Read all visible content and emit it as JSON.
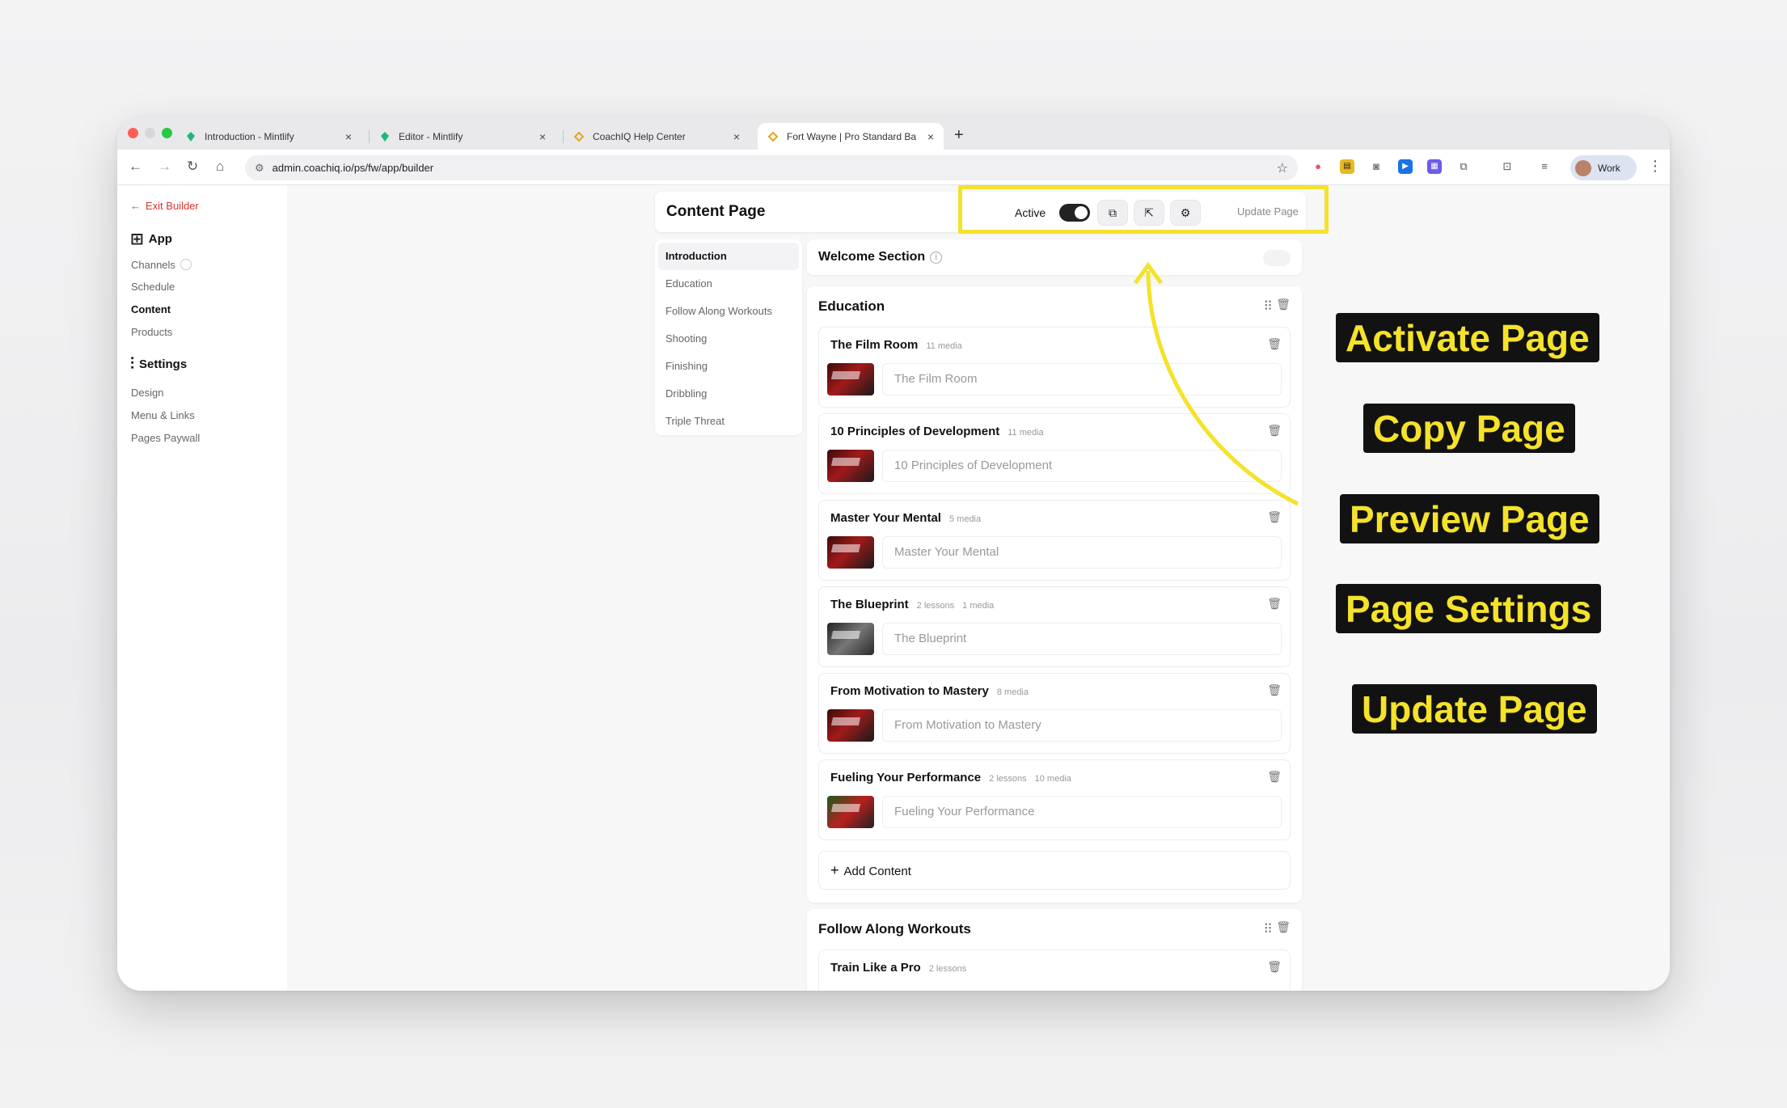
{
  "browser": {
    "tabs": [
      {
        "title": "Introduction - Mintlify",
        "icon": "mintlify-icon"
      },
      {
        "title": "Editor - Mintlify",
        "icon": "mintlify-icon"
      },
      {
        "title": "CoachIQ Help Center",
        "icon": "coachiq-icon"
      },
      {
        "title": "Fort Wayne | Pro Standard Ba",
        "icon": "coachiq-icon"
      }
    ],
    "url": "admin.coachiq.io/ps/fw/app/builder",
    "profile": "Work"
  },
  "sidebar": {
    "exit": "Exit Builder",
    "app_heading": "App",
    "app_items": [
      "Channels",
      "Schedule",
      "Content",
      "Products"
    ],
    "settings_heading": "Settings",
    "settings_items": [
      "Design",
      "Menu & Links",
      "Pages Paywall"
    ]
  },
  "header": {
    "title": "Content Page",
    "active_label": "Active",
    "update_label": "Update Page"
  },
  "pages": [
    "Introduction",
    "Education",
    "Follow Along Workouts",
    "Shooting",
    "Finishing",
    "Dribbling",
    "Triple Threat"
  ],
  "welcome": {
    "title": "Welcome Section",
    "info": "i"
  },
  "education": {
    "title": "Education",
    "items": [
      {
        "title": "The Film Room",
        "meta": "11 media",
        "meta2": "",
        "placeholder": "The Film Room"
      },
      {
        "title": "10 Principles of Development",
        "meta": "11 media",
        "meta2": "",
        "placeholder": "10 Principles of Development"
      },
      {
        "title": "Master Your Mental",
        "meta": "5 media",
        "meta2": "",
        "placeholder": "Master Your Mental"
      },
      {
        "title": "The Blueprint",
        "meta": "2 lessons",
        "meta2": "1 media",
        "placeholder": "The Blueprint"
      },
      {
        "title": "From Motivation to Mastery",
        "meta": "8 media",
        "meta2": "",
        "placeholder": "From Motivation to Mastery"
      },
      {
        "title": "Fueling Your Performance",
        "meta": "2 lessons",
        "meta2": "10 media",
        "placeholder": "Fueling Your Performance"
      }
    ],
    "add_label": "Add Content"
  },
  "follow": {
    "title": "Follow Along Workouts",
    "items": [
      {
        "title": "Train Like a Pro",
        "meta": "2 lessons"
      }
    ]
  },
  "annotations": [
    "Activate Page",
    "Copy Page",
    "Preview Page",
    "Page Settings",
    "Update Page"
  ],
  "colors": {
    "highlight": "#f5e22a",
    "accent_red": "#e0322f",
    "annotation_bg": "#121212"
  }
}
